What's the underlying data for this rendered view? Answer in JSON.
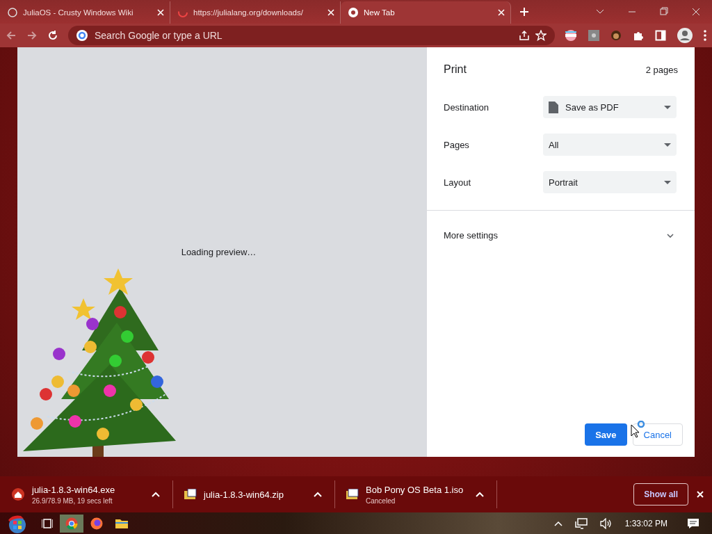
{
  "tabs": [
    {
      "title": "JuliaOS - Crusty Windows Wiki",
      "selected": false,
      "kind": "site"
    },
    {
      "title": "https://julialang.org/downloads/",
      "selected": false,
      "kind": "loading"
    },
    {
      "title": "New Tab",
      "selected": true,
      "kind": "chrome"
    }
  ],
  "address_bar": {
    "placeholder": "Search Google or type a URL"
  },
  "print": {
    "title": "Print",
    "page_count": "2 pages",
    "preview_status": "Loading preview…",
    "settings": [
      {
        "label": "Destination",
        "value": "Save as PDF",
        "kind": "destination"
      },
      {
        "label": "Pages",
        "value": "All",
        "kind": "select"
      },
      {
        "label": "Layout",
        "value": "Portrait",
        "kind": "select"
      }
    ],
    "more_settings": {
      "label": "More settings",
      "expanded": false
    },
    "buttons": [
      {
        "label": "Save",
        "kind": "primary"
      },
      {
        "label": "Cancel",
        "kind": "secondary"
      }
    ]
  },
  "downloads": [
    {
      "name": "julia-1.8.3-win64.exe",
      "status": "26.9/78.9 MB, 19 secs left",
      "kind": "exe"
    },
    {
      "name": "julia-1.8.3-win64.zip",
      "kind": "zip"
    },
    {
      "name": "Bob Pony OS Beta 1.iso",
      "status": "Canceled",
      "kind": "iso"
    }
  ],
  "show_all": "Show all",
  "taskbar": {
    "clock": "1:33:02 PM"
  }
}
